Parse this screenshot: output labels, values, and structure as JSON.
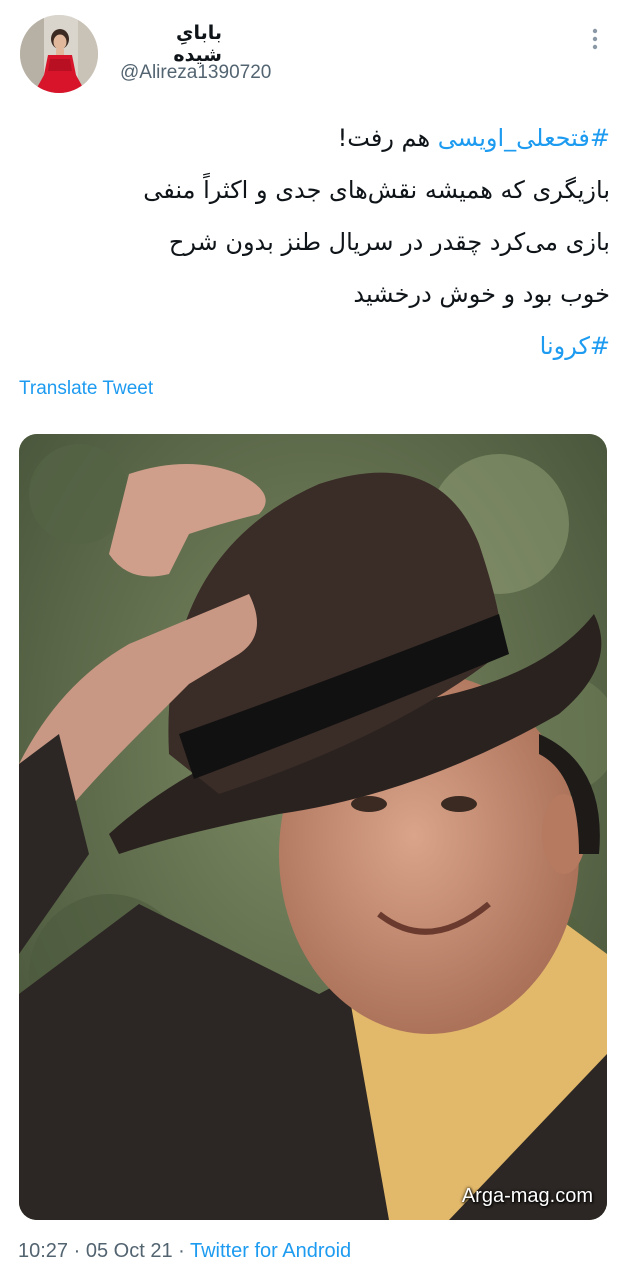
{
  "user": {
    "display_name": "باباىِ شیده",
    "handle": "@Alireza1390720",
    "avatar_icon": "avatar-girl-red-dress"
  },
  "tweet": {
    "lines": [
      {
        "hashtag": "#فتحعلی_اویسی",
        "text": " هم رفت!"
      },
      {
        "text": "بازیگری که همیشه نقش‌های جدی و اکثراً منفی"
      },
      {
        "text": "بازی می‌کرد چقدر در سریال طنز بدون شرح"
      },
      {
        "text": "خوب بود و خوش درخشید"
      },
      {
        "hashtag": "#کرونا"
      }
    ],
    "translate_label": "Translate Tweet"
  },
  "media": {
    "watermark": "Arga-mag.com"
  },
  "footer": {
    "time": "10:27",
    "separator": " · ",
    "date": "05 Oct 21",
    "app": "Twitter for Android"
  },
  "colors": {
    "link": "#1d9bf0",
    "secondary_text": "#536471",
    "primary_text": "#0f1419"
  },
  "icons": {
    "more": "more-vertical-icon"
  }
}
